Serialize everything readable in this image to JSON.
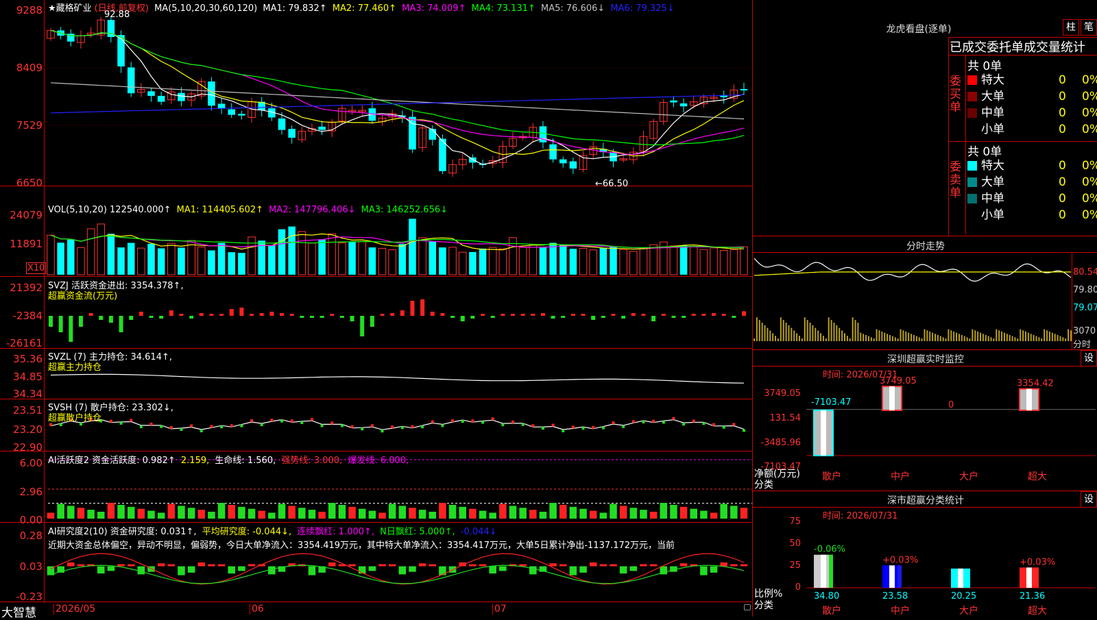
{
  "stock": {
    "name": "★藏格矿业",
    "period": "(日线,前复权)",
    "ma_header": "MA(5,10,20,30,60,120)",
    "ma": [
      {
        "label": "MA1:",
        "value": "79.832↑",
        "color": "#ffffff"
      },
      {
        "label": "MA2:",
        "value": "77.460↑",
        "color": "#ffff00"
      },
      {
        "label": "MA3:",
        "value": "74.009↑",
        "color": "#ff00ff"
      },
      {
        "label": "MA4:",
        "value": "73.131↑",
        "color": "#00ff00"
      },
      {
        "label": "MA5:",
        "value": "76.606↓",
        "color": "#c0c0c0"
      },
      {
        "label": "MA6:",
        "value": "79.325↓",
        "color": "#2222ff"
      }
    ],
    "high_note": "92.88",
    "low_note": "←66.50"
  },
  "panes": {
    "price": {
      "ticks": [
        "9288",
        "8409",
        "7529",
        "6650"
      ]
    },
    "vol": {
      "ticks": [
        "24079",
        "11891"
      ],
      "x10": "X10",
      "header": [
        {
          "label": "VOL(5,10,20)",
          "value": "122540.000↑",
          "color": "#ffffff"
        },
        {
          "label": "MA1:",
          "value": "114405.602↑",
          "color": "#ffff00"
        },
        {
          "label": "MA2:",
          "value": "147796.406↓",
          "color": "#ff00ff"
        },
        {
          "label": "MA3:",
          "value": "146252.656↓",
          "color": "#00ff00"
        }
      ]
    },
    "svzj": {
      "ticks": [
        "21392",
        "-2384",
        "-26161"
      ],
      "line1": "SVZJ  活跃资金进出: 3354.378↑,",
      "line2": "超赢资金流(万元)"
    },
    "svzl": {
      "ticks": [
        "35.36",
        "34.85",
        "34.34"
      ],
      "line1": "SVZL (7) 主力持仓: 34.614↑,",
      "line2": "超赢主力持仓"
    },
    "svsh": {
      "ticks": [
        "23.51",
        "23.20",
        "22.90"
      ],
      "line1": "SVSH (7) 散户持仓: 23.302↓,",
      "line2": "超赢散户持仓"
    },
    "ai1": {
      "ticks": [
        "6.00",
        "2.96",
        "0.00"
      ],
      "header": [
        {
          "text": "AI活跃度2 资金活跃度: 0.982↑",
          "color": "#ffffff"
        },
        {
          "text": "2.159,",
          "color": "#ffff00"
        },
        {
          "text": "生命线: 1.560,",
          "color": "#ffffff"
        },
        {
          "text": "强势线: 3.000,",
          "color": "#ff3333"
        },
        {
          "text": "爆发线: 6.000,",
          "color": "#ff00ff"
        }
      ]
    },
    "ai2": {
      "ticks": [
        "0.28",
        "0.03",
        "-0.23"
      ],
      "header": [
        {
          "text": "AI研究度2(10) 资金研究度: 0.031↑,",
          "color": "#ffffff"
        },
        {
          "text": "平均研究度: -0.044↓,",
          "color": "#ffff00"
        },
        {
          "text": "连续飘红: 1.000↑,",
          "color": "#ff00ff"
        },
        {
          "text": "N日飘红: 5.000↑,",
          "color": "#00ff00"
        },
        {
          "text": "-0.044↓",
          "color": "#2222ff"
        }
      ],
      "comment": "近期大资金总体偏空，异动不明显，偏弱势，今日大单净流入：3354.419万元，其中特大单净流入：3354.417万元，大单5日累计净出-1137.172万元，当前"
    }
  },
  "date_axis": {
    "labels": [
      "2026/05",
      "06",
      "07"
    ],
    "bottom_left": "大智慧"
  },
  "right_panel": {
    "dragon_title": "龙虎看盘(逐单)",
    "btn_zhu": "柱",
    "btn_bi": "笔",
    "stats_header": "已成交委托单成交量统计",
    "buy_label": "委买单",
    "sell_label": "委卖单",
    "buy_total": "共 0单",
    "sell_total": "共 0单",
    "buy_rows": [
      {
        "name": "特大",
        "count": "0",
        "pct": "0%",
        "color": "#ff0000"
      },
      {
        "name": "大单",
        "count": "0",
        "pct": "0%",
        "color": "#8b0000"
      },
      {
        "name": "中单",
        "count": "0",
        "pct": "0%",
        "color": "#6b0000"
      },
      {
        "name": "小单",
        "count": "0",
        "pct": "0%",
        "color": ""
      }
    ],
    "sell_rows": [
      {
        "name": "特大",
        "count": "0",
        "pct": "0%",
        "color": "#00ffff"
      },
      {
        "name": "大单",
        "count": "0",
        "pct": "0%",
        "color": "#008b8b"
      },
      {
        "name": "中单",
        "count": "0",
        "pct": "0%",
        "color": "#007070"
      },
      {
        "name": "小单",
        "count": "0",
        "pct": "0%",
        "color": ""
      }
    ],
    "intraday": {
      "title": "分时走势",
      "ticks": [
        "80.54",
        "79.80",
        "79.07",
        "3070",
        "分时"
      ]
    },
    "monitor": {
      "title": "深圳超赢实时监控",
      "btn": "设",
      "time": "时间: 2026/07/31",
      "ticks": [
        "3749.05",
        "131.54",
        "-3485.96",
        "-7103.47"
      ],
      "ylabel": "净额(万元)",
      "xlabel": "分类",
      "cats": [
        "散户",
        "中户",
        "大户",
        "超大"
      ],
      "values": [
        -7103.47,
        3749.05,
        0,
        3354.42
      ],
      "value_labels": [
        "-7103.47",
        "3749.05",
        "0",
        "3354.42"
      ]
    },
    "classify": {
      "title": "深市超赢分类统计",
      "btn": "设",
      "time": "时间: 2026/07/31",
      "ticks": [
        "75",
        "50",
        "25",
        "0"
      ],
      "ylabel": "比例%",
      "xlabel": "分类",
      "cats": [
        "散户",
        "中户",
        "大户",
        "超大"
      ],
      "values": [
        34.8,
        23.58,
        20.25,
        21.36
      ],
      "value_labels": [
        "34.80",
        "23.58",
        "20.25",
        "21.36"
      ],
      "changes": [
        "-0.06%",
        "+0.03%",
        "",
        "+0.03%"
      ]
    }
  },
  "chart_data": [
    {
      "type": "candlestick",
      "title": "★藏格矿业(日线,前复权)",
      "ylim": [
        6650,
        9288
      ],
      "high": 9288,
      "low": 6650,
      "ma_values": {
        "MA1": 79.832,
        "MA2": 77.46,
        "MA3": 74.009,
        "MA4": 73.131,
        "MA5": 76.606,
        "MA6": 79.325
      },
      "close": [
        8980,
        8900,
        8810,
        8900,
        8940,
        9140,
        8880,
        8430,
        8020,
        8080,
        7980,
        7890,
        8040,
        7900,
        8010,
        8200,
        7830,
        7790,
        7690,
        7680,
        7890,
        7760,
        7650,
        7460,
        7340,
        7440,
        7480,
        7460,
        7580,
        7790,
        7760,
        7760,
        7600,
        7640,
        7710,
        7660,
        7160,
        7490,
        7310,
        6830,
        6930,
        7010,
        6960,
        6930,
        6990,
        7210,
        7330,
        7360,
        7500,
        7270,
        7010,
        6950,
        6870,
        7070,
        7200,
        7120,
        6980,
        7020,
        7120,
        7360,
        7590,
        7880,
        7880,
        7820,
        7890,
        7960,
        7960,
        7960,
        8070,
        8070
      ]
    },
    {
      "type": "bar",
      "title": "VOL(5,10,20)",
      "values": [
        174000,
        141000,
        154000,
        119000,
        202000,
        223000,
        180000,
        120000,
        140000,
        117000,
        136000,
        116000,
        138000,
        119000,
        150000,
        122000,
        107000,
        140000,
        99000,
        96000,
        166000,
        150000,
        130000,
        200000,
        212000,
        190000,
        139000,
        156000,
        180000,
        140000,
        145000,
        145000,
        120000,
        116000,
        110000,
        135000,
        246000,
        163000,
        146000,
        120000,
        121000,
        99000,
        100000,
        115000,
        120000,
        114000,
        163000,
        120000,
        133000,
        122000,
        140000,
        131000,
        114000,
        116000,
        109000,
        117000,
        123000,
        111000,
        103000,
        117000,
        132000,
        144000,
        127000,
        128000,
        124000,
        111000,
        118000,
        107000,
        110000,
        122540
      ]
    },
    {
      "type": "bar",
      "title": "SVZJ 活跃资金进出",
      "values": [
        -8000,
        -12000,
        -19000,
        -8000,
        2000,
        -3000,
        -5000,
        -12000,
        -3000,
        3000,
        -1000,
        -2000,
        4000,
        1000,
        -2000,
        2000,
        1000,
        1500,
        5000,
        6000,
        1000,
        2000,
        3000,
        2000,
        1000,
        -1500,
        -500,
        -1000,
        1000,
        -1000,
        -4000,
        -15000,
        -8000,
        1000,
        2000,
        4000,
        11000,
        12000,
        3000,
        2000,
        -500,
        -4000,
        -2000,
        1000,
        -1500,
        1000,
        1000,
        1000,
        1000,
        2000,
        -2000,
        -1000,
        1000,
        1000,
        -3000,
        -1000,
        1000,
        -2000,
        2000,
        1000,
        -4000,
        1000,
        -500,
        -1000,
        1000,
        500,
        2000,
        1000,
        -1000,
        3354
      ]
    },
    {
      "type": "line",
      "title": "SVZL 主力持仓",
      "ylim": [
        34.34,
        35.36
      ],
      "last": 34.614
    },
    {
      "type": "line",
      "title": "SVSH 散户持仓",
      "ylim": [
        22.9,
        23.51
      ],
      "last": 23.302
    },
    {
      "type": "bar",
      "title": "AI活跃度2",
      "ylim": [
        0,
        6
      ],
      "last": 0.982,
      "ref_lines": [
        1.56,
        3.0,
        6.0
      ]
    },
    {
      "type": "bar",
      "title": "AI研究度2(10)",
      "ylim": [
        -0.23,
        0.28
      ],
      "last": 0.031
    }
  ]
}
